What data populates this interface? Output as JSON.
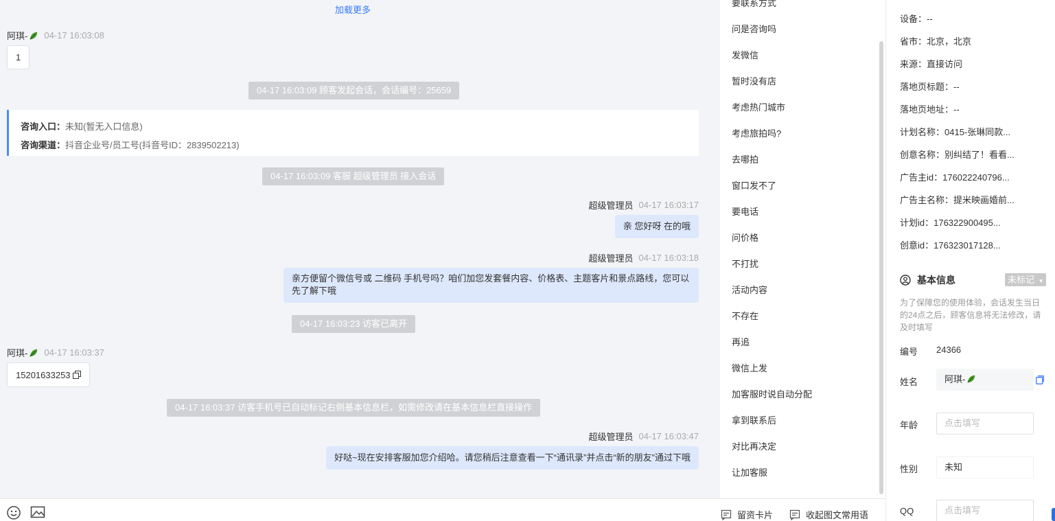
{
  "chat": {
    "load_more": "加载更多",
    "messages": [
      {
        "sender": "阿琪-",
        "time": "04-17 16:03:08",
        "text": "1"
      },
      {
        "system": "04-17 16:03:09 顾客发起会话，会话编号：25659"
      },
      {
        "system": "04-17 16:03:09 客服 超级管理员 接入会话"
      },
      {
        "sender": "超级管理员",
        "time": "04-17 16:03:17",
        "text": "亲 您好呀 在的哦"
      },
      {
        "sender": "超级管理员",
        "time": "04-17 16:03:18",
        "text": "亲方便留个微信号或 二维码 手机号吗？咱们加您发套餐内容、价格表、主题客片和景点路线，您可以先了解下哦"
      },
      {
        "system": "04-17 16:03:23 访客已离开"
      },
      {
        "sender": "阿琪-",
        "time": "04-17 16:03:37",
        "text": "15201633253"
      },
      {
        "system": "04-17 16:03:37 访客手机号已自动标记右侧基本信息栏，如需修改请在基本信息栏直接操作"
      },
      {
        "sender": "超级管理员",
        "time": "04-17 16:03:47",
        "text": "好哒~现在安排客服加您介绍哈。请您稍后注意查看一下“通讯录”并点击“新的朋友”通过下哦"
      }
    ],
    "entry": {
      "label1": "咨询入口：",
      "value1": "未知(暂无入口信息)",
      "label2": "咨询渠道：",
      "value2": "抖音企业号/员工号(抖音号ID：2839502213)"
    }
  },
  "toolbar": {
    "emoji_icon": "smile-icon",
    "image_icon": "image-icon",
    "card_label": "留资卡片",
    "collapse_label": "收起图文常用语"
  },
  "phrases": {
    "items": [
      "要联系方式",
      "问是咨询吗",
      "发微信",
      "暂时没有店",
      "考虑热门城市",
      "考虑旅拍吗?",
      "去哪拍",
      "窗口发不了",
      "要电话",
      "问价格",
      "不打扰",
      "活动内容",
      "不存在",
      "再追",
      "微信上发",
      "加客服时说自动分配",
      "拿到联系后",
      "对比再决定",
      "让加客服"
    ]
  },
  "info": {
    "details": [
      "设备：--",
      "省市：北京，北京",
      "来源：直接访问",
      "落地页标题：--",
      "落地页地址：--",
      "计划名称：0415-张琳同款...",
      "创意名称：别纠结了！看看...",
      "广告主id：176022240796...",
      "广告主名称：提米映画婚前...",
      "计划id：176322900495...",
      "创意id：176323017128..."
    ],
    "section_title": "基本信息",
    "mark_label": "未标记",
    "tip": "为了保障您的使用体验，会话发生当日的24点之后，顾客信息将无法修改，请及时填写",
    "fields": {
      "id_label": "编号",
      "id_value": "24366",
      "name_label": "姓名",
      "name_value": "阿琪-",
      "age_label": "年龄",
      "age_placeholder": "点击填写",
      "gender_label": "性别",
      "gender_value": "未知",
      "qq_label": "QQ",
      "qq_placeholder": "点击填写"
    }
  },
  "colors": {
    "accent": "#3a7bff",
    "bubble_out": "#dde8fc",
    "system_bg": "#d0d1d4",
    "chat_bg": "#f3f4f7"
  }
}
